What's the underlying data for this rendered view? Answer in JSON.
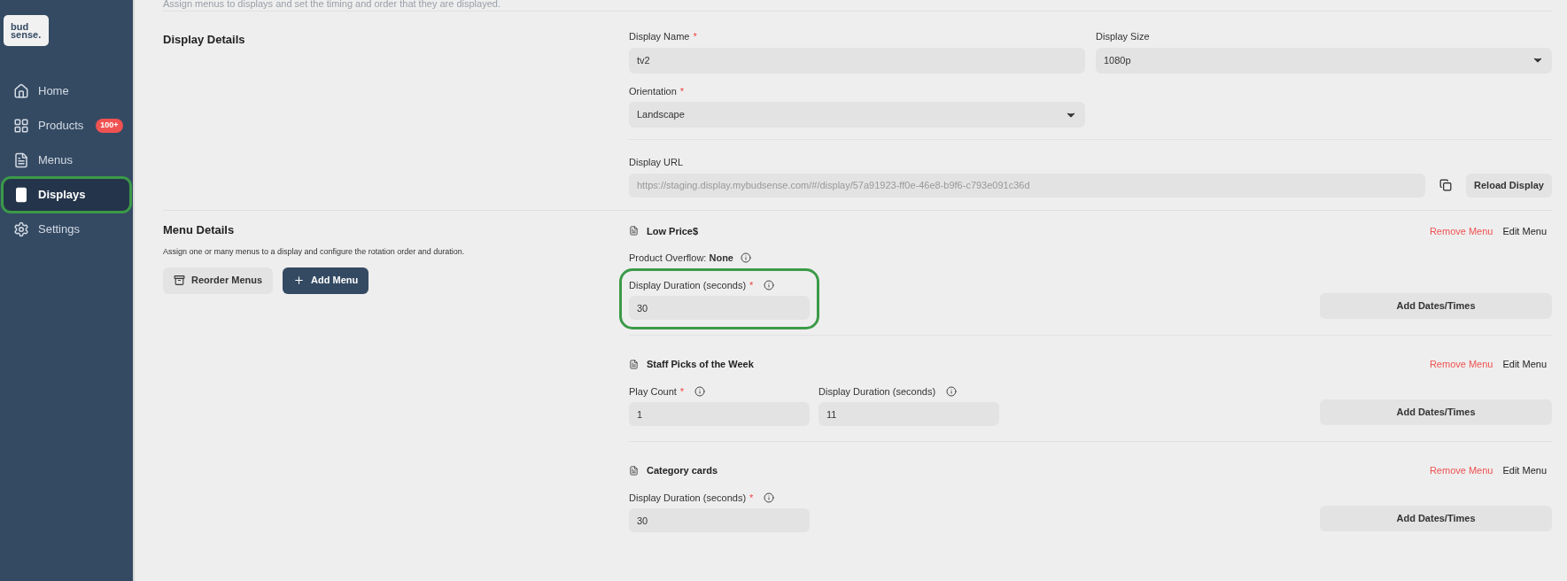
{
  "sidebar": {
    "logo": [
      "bud",
      "sense."
    ],
    "items": [
      {
        "kind": "home",
        "label": "Home",
        "selected": false,
        "highlighted": false
      },
      {
        "kind": "products",
        "label": "Products",
        "badge": "100+",
        "selected": false,
        "highlighted": false
      },
      {
        "kind": "menus",
        "label": "Menus",
        "selected": false,
        "highlighted": false
      },
      {
        "kind": "displays",
        "label": "Displays",
        "selected": true,
        "highlighted": true
      },
      {
        "kind": "settings",
        "label": "Settings",
        "selected": false,
        "highlighted": false
      }
    ]
  },
  "header": {
    "subtitle": "Assign menus to displays and set the timing and order that they are displayed."
  },
  "display_details": {
    "title": "Display Details",
    "display_name": {
      "label": "Display Name",
      "required_mark": "*",
      "value": "tv2"
    },
    "display_size": {
      "label": "Display Size",
      "value": "1080p"
    },
    "orientation": {
      "label": "Orientation",
      "required_mark": "*",
      "value": "Landscape"
    },
    "display_url": {
      "label": "Display URL",
      "value": "https://staging.display.mybudsense.com/#/display/57a91923-ff0e-46e8-b9f6-c793e091c36d"
    },
    "reload_button": "Reload Display"
  },
  "menu_details": {
    "title": "Menu Details",
    "description": "Assign one or many menus to a display and configure the rotation order and duration.",
    "reorder_button": "Reorder Menus",
    "add_button": "Add Menu",
    "menus": [
      {
        "name": "Low Price$",
        "remove": "Remove Menu",
        "edit": "Edit Menu",
        "overflow_label": "Product Overflow:",
        "overflow_value": "None",
        "add_dates": "Add Dates/Times",
        "fields": [
          {
            "label": "Display Duration (seconds)",
            "required_mark": "*",
            "value": "30",
            "highlighted": true
          }
        ]
      },
      {
        "name": "Staff Picks of the Week",
        "remove": "Remove Menu",
        "edit": "Edit Menu",
        "add_dates": "Add Dates/Times",
        "fields": [
          {
            "label": "Play Count",
            "required_mark": "*",
            "value": "1"
          },
          {
            "label": "Display Duration (seconds)",
            "value": "11"
          }
        ]
      },
      {
        "name": "Category cards",
        "remove": "Remove Menu",
        "edit": "Edit Menu",
        "add_dates": "Add Dates/Times",
        "fields": [
          {
            "label": "Display Duration (seconds)",
            "required_mark": "*",
            "value": "30"
          }
        ]
      }
    ]
  }
}
